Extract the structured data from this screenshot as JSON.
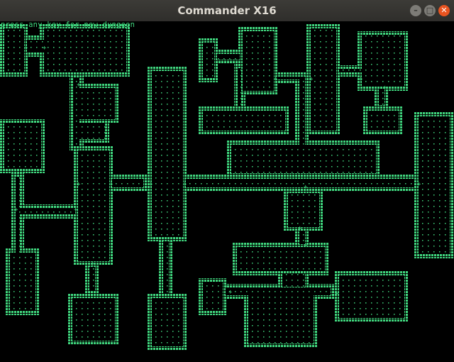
{
  "window": {
    "title": "Commander X16",
    "minimize_glyph": "–",
    "maximize_glyph": "□",
    "close_glyph": "✕"
  },
  "game": {
    "status_text": "press any key for new dungeon",
    "palette": {
      "background": "#000000",
      "wall": "#3fd57d",
      "wall_dark": "#1f8f4e",
      "floor_dot": "#3fd57d",
      "door": "#3fd57d"
    },
    "icons": {
      "wall": "hash-wall-tile",
      "floor": "dot-floor-tile",
      "door": "plus-door-tile"
    }
  }
}
